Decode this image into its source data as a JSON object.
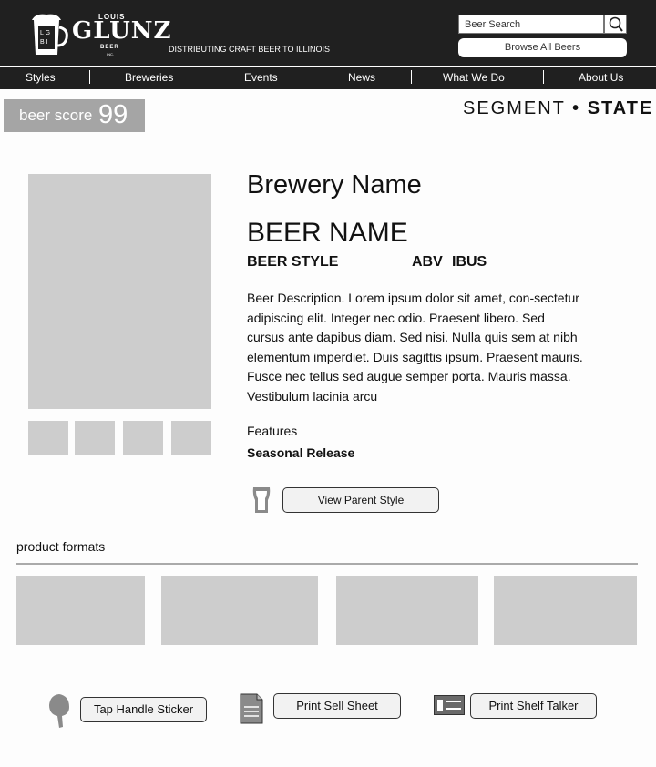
{
  "header": {
    "logo": {
      "louis": "LOUIS",
      "glunz": "GLUNZ",
      "beer": "BEER",
      "inc": "INC.",
      "badge_letters": "LGBI"
    },
    "tagline": "DISTRIBUTING CRAFT BEER TO ILLINOIS",
    "search_value": "Beer Search",
    "browse_label": "Browse All Beers"
  },
  "nav": {
    "items": [
      {
        "label": "Styles"
      },
      {
        "label": "Breweries"
      },
      {
        "label": "Events"
      },
      {
        "label": "News"
      },
      {
        "label": "What We Do"
      },
      {
        "label": "About Us"
      }
    ]
  },
  "score": {
    "label": "beer score",
    "value": "99"
  },
  "segment": {
    "segment": "SEGMENT",
    "dot": "•",
    "state": "STATE"
  },
  "beer": {
    "brewery": "Brewery Name",
    "name": "BEER NAME",
    "style": "BEER STYLE",
    "abv": "ABV",
    "ibus": "IBUS",
    "description": "Beer Description. Lorem ipsum dolor sit amet, con-sectetur adipiscing elit. Integer nec odio. Praesent libero. Sed cursus ante dapibus diam. Sed nisi. Nulla quis sem at nibh elementum imperdiet. Duis sagittis ipsum. Praesent mauris. Fusce nec tellus sed augue semper porta. Mauris massa. Vestibulum lacinia arcu",
    "features_label": "Features",
    "feature_value": "Seasonal Release",
    "parent_style_btn": "View Parent Style"
  },
  "product_formats": {
    "label": "product formats"
  },
  "actions": {
    "tap_handle": "Tap Handle Sticker",
    "sell_sheet": "Print Sell Sheet",
    "shelf_talker": "Print Shelf Talker"
  },
  "colors": {
    "header_bg": "#202020",
    "placeholder_gray": "#cdcdcd",
    "score_bg": "#a5a5a5"
  }
}
